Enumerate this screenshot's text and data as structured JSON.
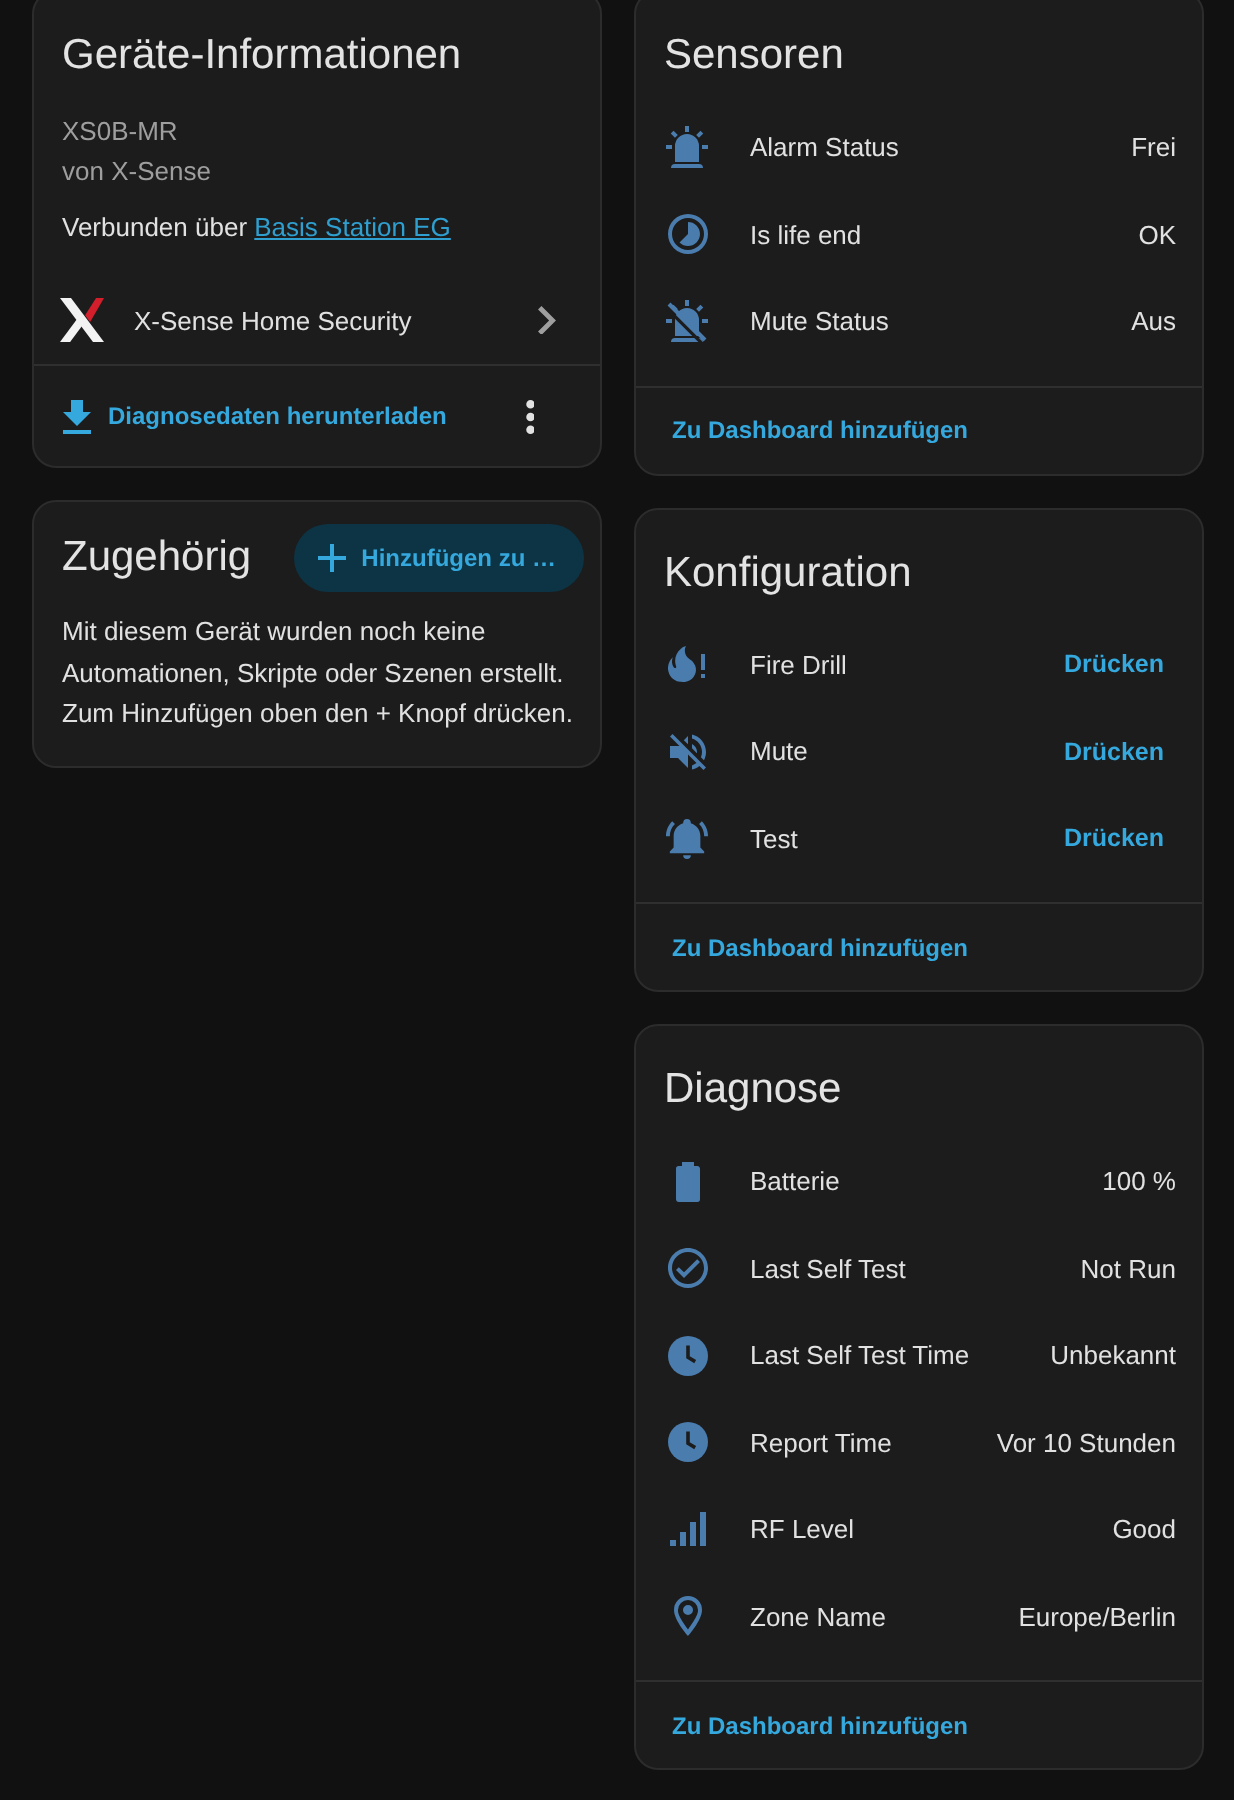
{
  "device_info": {
    "title": "Geräte-Informationen",
    "model": "XS0B-MR",
    "manufacturer": "von X-Sense",
    "connection": {
      "label": "Verbunden über",
      "link": "Basis Station EG"
    },
    "integration": "X-Sense Home Security",
    "download_button": "Diagnosedaten herunterladen"
  },
  "related": {
    "title": "Zugehörig",
    "add_button": "Hinzufügen zu …",
    "message": "Mit diesem Gerät wurden noch keine Automationen, Skripte oder Szenen erstellt. Zum Hinzufügen oben den + Knopf drücken."
  },
  "entity_cards": [
    {
      "title": "Sensoren",
      "rows": [
        {
          "kind": "state",
          "name": "Alarm Status",
          "value": "Frei"
        },
        {
          "kind": "state",
          "name": "Is life end",
          "value": "OK"
        },
        {
          "kind": "state",
          "name": "Mute Status",
          "value": "Aus"
        }
      ],
      "footer_button": "Zu Dashboard hinzufügen"
    },
    {
      "title": "Konfiguration",
      "rows": [
        {
          "kind": "button",
          "name": "Fire Drill",
          "button": "Drücken"
        },
        {
          "kind": "button",
          "name": "Mute",
          "button": "Drücken"
        },
        {
          "kind": "button",
          "name": "Test",
          "button": "Drücken"
        }
      ],
      "footer_button": "Zu Dashboard hinzufügen"
    },
    {
      "title": "Diagnose",
      "rows": [
        {
          "kind": "state",
          "name": "Batterie",
          "value": "100 %"
        },
        {
          "kind": "state",
          "name": "Last Self Test",
          "value": "Not Run"
        },
        {
          "kind": "state",
          "name": "Last Self Test Time",
          "value": "Unbekannt"
        },
        {
          "kind": "state",
          "name": "Report Time",
          "value": "Vor 10 Stunden"
        },
        {
          "kind": "state",
          "name": "RF Level",
          "value": "Good"
        },
        {
          "kind": "state",
          "name": "Zone Name",
          "value": "Europe/Berlin"
        }
      ],
      "footer_button": "Zu Dashboard hinzufügen"
    }
  ]
}
